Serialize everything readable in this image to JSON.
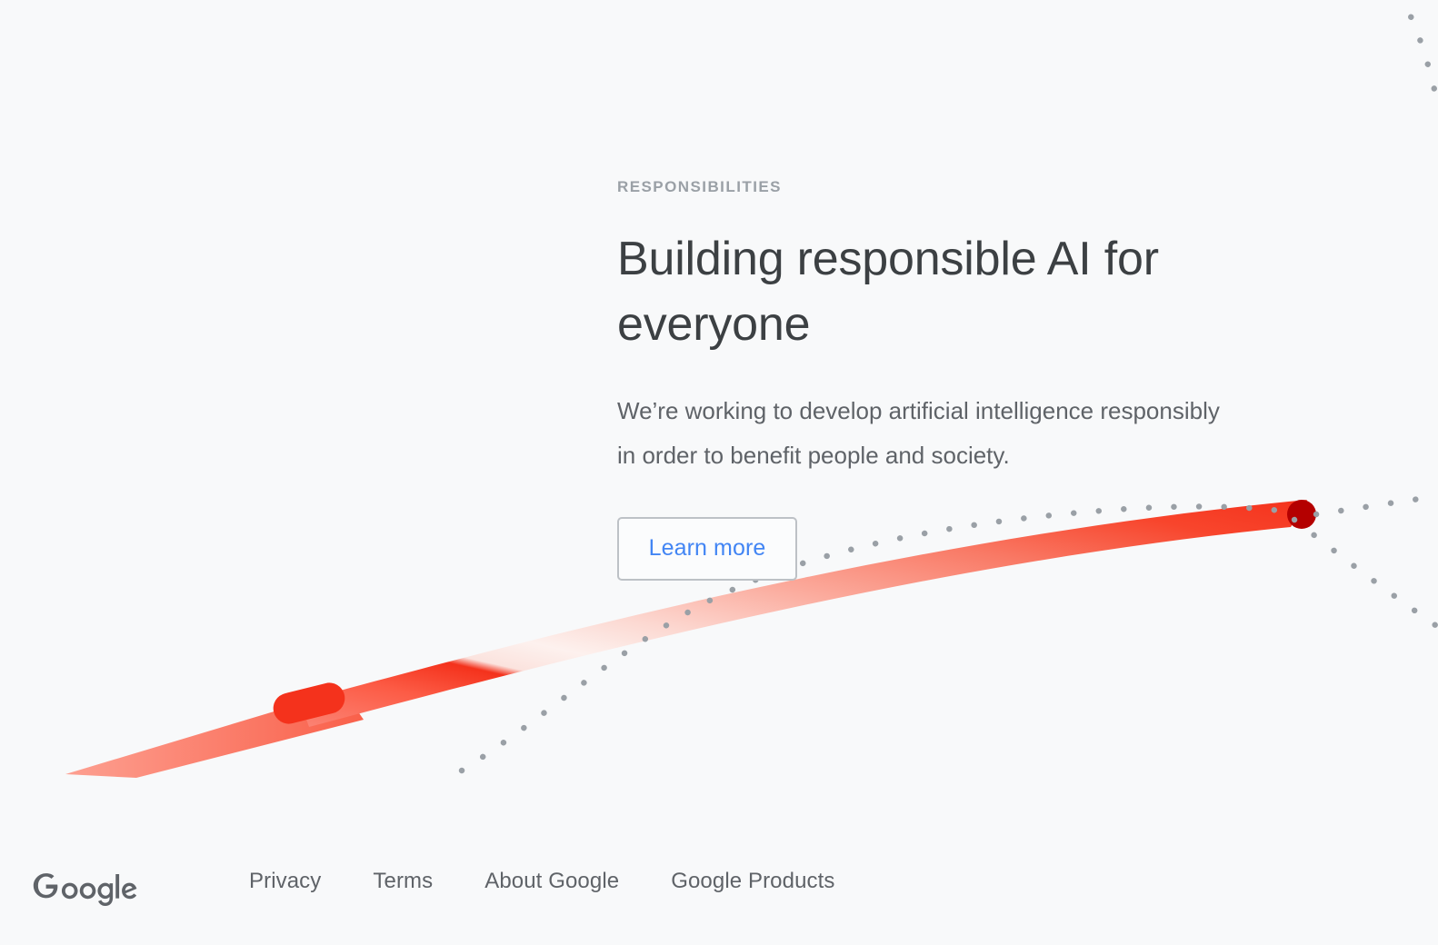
{
  "page": {
    "background_color": "#f8f9fa",
    "text_color": "#3c4043",
    "muted_text_color": "#5f6368"
  },
  "hero": {
    "eyebrow": "RESPONSIBILITIES",
    "headline": "Building responsible AI for everyone",
    "subhead": "We’re working to develop artificial intelligence responsibly in order to benefit people and society.",
    "cta_label": "Learn more",
    "cta_text_color": "#4285f4",
    "cta_border_color": "#bdc1c6",
    "eyebrow_color": "#9aa0a6"
  },
  "artwork": {
    "ribbon_label": "red-ribbon-swoosh",
    "ribbon_bright_color": "#f4321c",
    "ribbon_dark_dot_color": "#b40000",
    "ribbon_fade_color": "#fdece9",
    "dot_color": "#9aa0a6",
    "dotted_curve_labels": [
      "dotted-curve-rising",
      "dotted-curve-descending",
      "dotted-curve-top-right"
    ]
  },
  "footer": {
    "logo_text": "Google",
    "logo_color": "#5f6368",
    "links": [
      {
        "label": "Privacy"
      },
      {
        "label": "Terms"
      },
      {
        "label": "About Google"
      },
      {
        "label": "Google Products"
      }
    ]
  }
}
